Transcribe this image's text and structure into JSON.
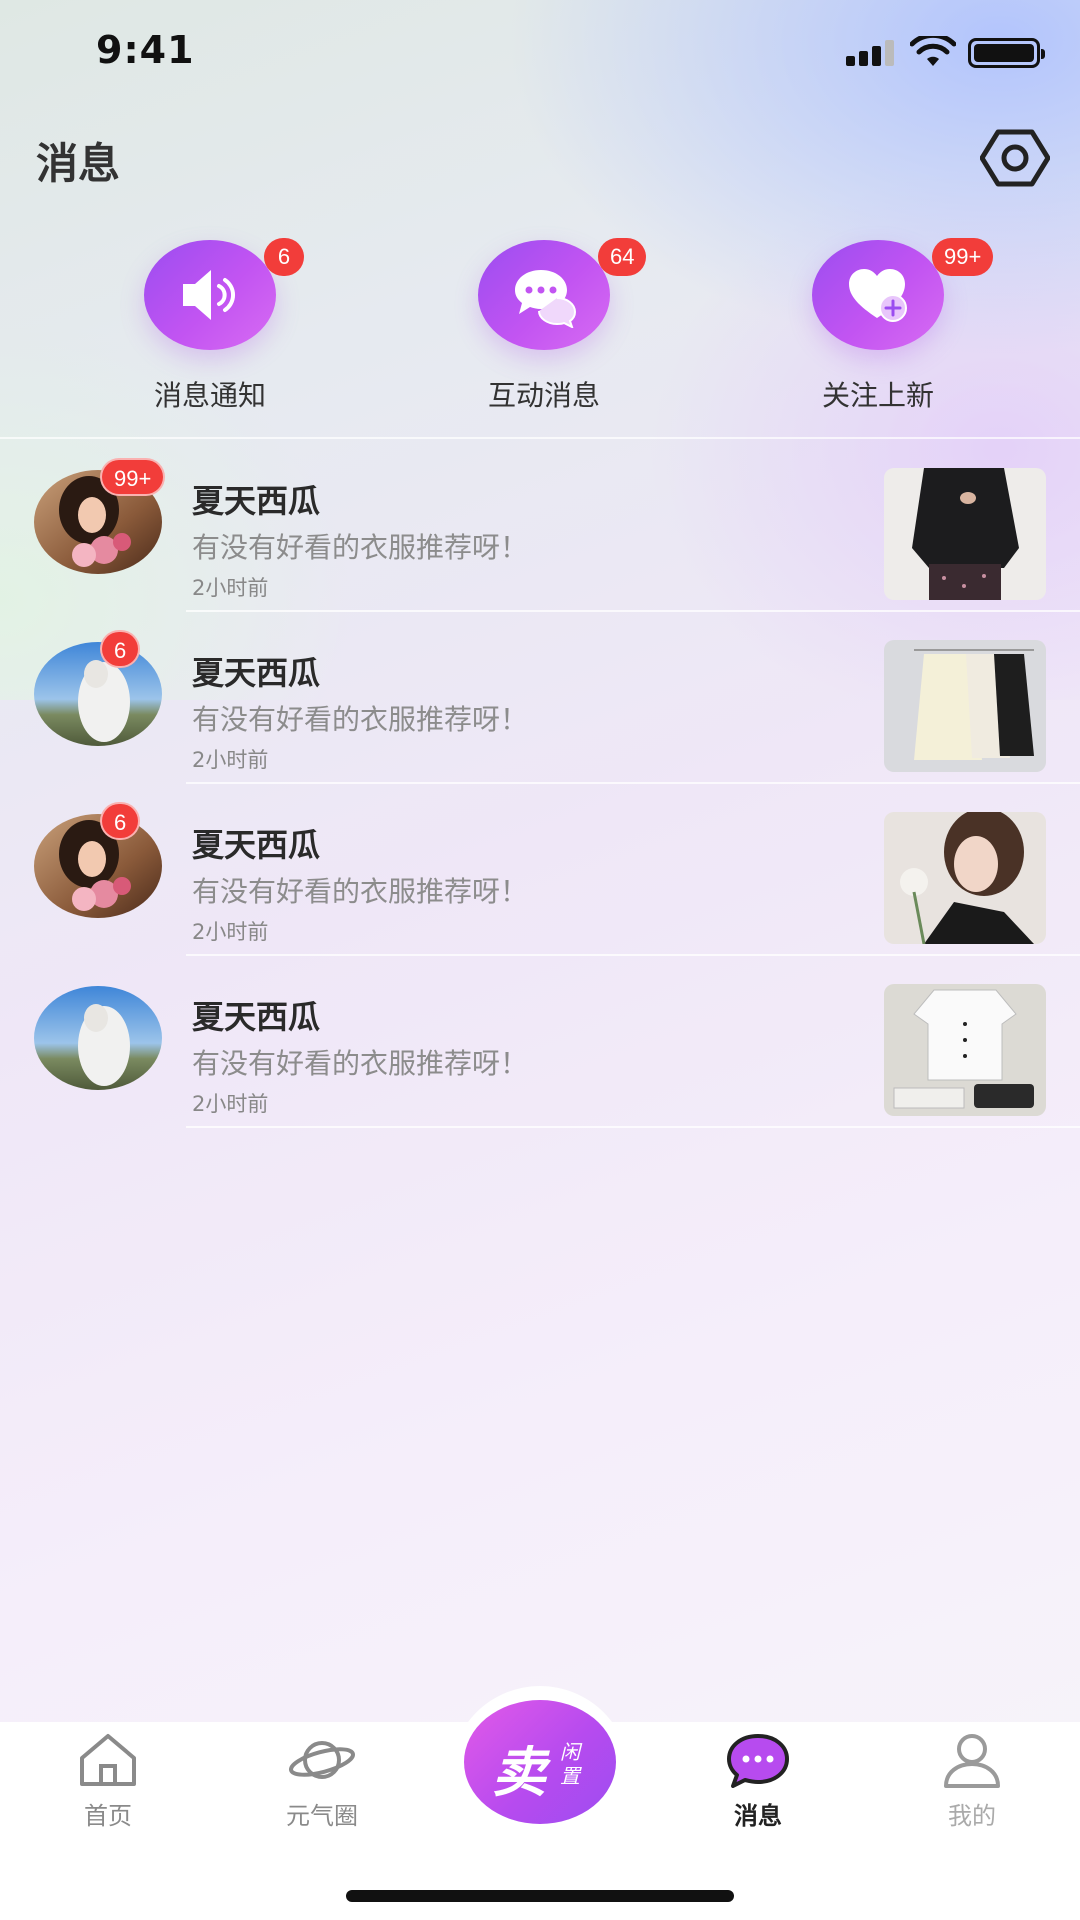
{
  "status_bar": {
    "time": "9:41"
  },
  "header": {
    "title": "消息"
  },
  "quick_actions": [
    {
      "label": "消息通知",
      "badge": "6",
      "icon": "speaker-icon"
    },
    {
      "label": "互动消息",
      "badge": "64",
      "icon": "chat-bubbles-icon"
    },
    {
      "label": "关注上新",
      "badge": "99+",
      "icon": "heart-plus-icon"
    }
  ],
  "messages": [
    {
      "name": "夏天西瓜",
      "text": "有没有好看的衣服推荐呀！",
      "time": "2小时前",
      "badge": "99+",
      "avatar": "girl-flowers",
      "thumb": "black-blazer"
    },
    {
      "name": "夏天西瓜",
      "text": "有没有好看的衣服推荐呀！",
      "time": "2小时前",
      "badge": "6",
      "avatar": "girl-sky",
      "thumb": "shirts-rack"
    },
    {
      "name": "夏天西瓜",
      "text": "有没有好看的衣服推荐呀！",
      "time": "2小时前",
      "badge": "6",
      "avatar": "girl-flowers",
      "thumb": "woman-earring"
    },
    {
      "name": "夏天西瓜",
      "text": "有没有好看的衣服推荐呀！",
      "time": "2小时前",
      "badge": "",
      "avatar": "girl-sky",
      "thumb": "white-shirt"
    }
  ],
  "tabbar": {
    "home": "首页",
    "circle": "元气圈",
    "sell_main": "卖",
    "sell_sub": "闲置",
    "messages": "消息",
    "mine": "我的"
  },
  "colors": {
    "accent_purple": "#b74bef",
    "badge_red": "#f23d3a"
  }
}
